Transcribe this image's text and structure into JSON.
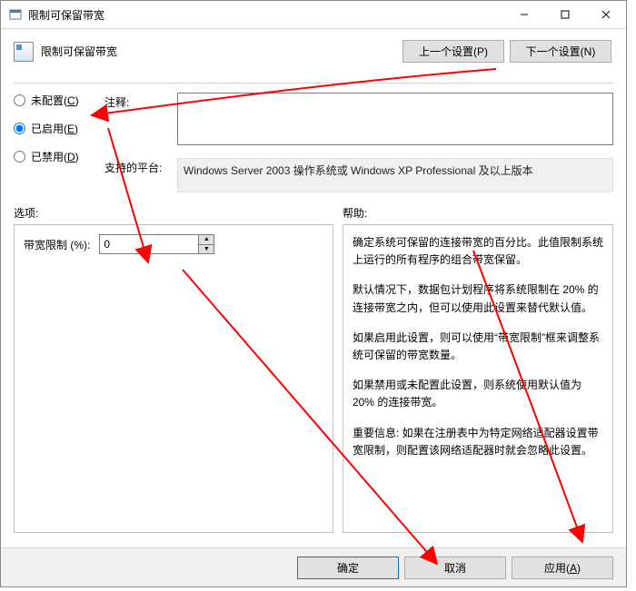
{
  "window": {
    "title": "限制可保留带宽"
  },
  "header": {
    "title": "限制可保留带宽",
    "prev_btn": "上一个设置(P)",
    "next_btn": "下一个设置(N)"
  },
  "radios": {
    "not_configured": "未配置(",
    "not_configured_u": "C",
    "enabled": "已启用(",
    "enabled_u": "E",
    "disabled": "已禁用(",
    "disabled_u": "D",
    "close_paren": ")"
  },
  "labels": {
    "comment": "注释:",
    "platform": "支持的平台:",
    "options": "选项:",
    "help": "帮助:"
  },
  "platform_text": "Windows Server 2003 操作系统或 Windows XP Professional 及以上版本",
  "options": {
    "bandwidth_label": "带宽限制 (%):",
    "bandwidth_value": "0"
  },
  "help": {
    "p1": "确定系统可保留的连接带宽的百分比。此值限制系统上运行的所有程序的组合带宽保留。",
    "p2": "默认情况下，数据包计划程序将系统限制在 20% 的连接带宽之内，但可以使用此设置来替代默认值。",
    "p3": "如果启用此设置，则可以使用“带宽限制”框来调整系统可保留的带宽数量。",
    "p4": "如果禁用或未配置此设置，则系统使用默认值为 20% 的连接带宽。",
    "p5": "重要信息: 如果在注册表中为特定网络适配器设置带宽限制，则配置该网络适配器时就会忽略此设置。"
  },
  "footer": {
    "ok": "确定",
    "cancel": "取消",
    "apply": "应用(",
    "apply_u": "A",
    "apply_close": ")"
  }
}
